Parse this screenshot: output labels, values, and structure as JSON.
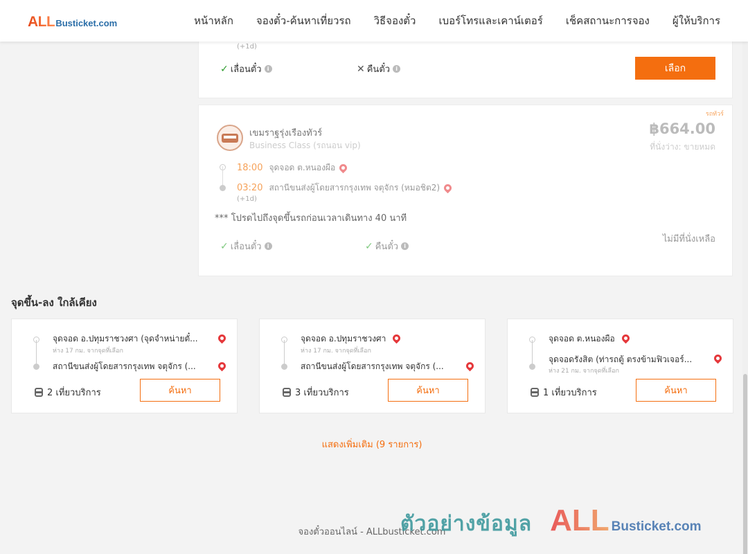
{
  "header": {
    "logo_all": "ALL",
    "logo_rest": "Busticket.com",
    "nav": [
      "หน้าหลัก",
      "จองตั๋ว-ค้นหาเที่ยวรถ",
      "วิธีจองตั๋ว",
      "เบอร์โทรและเคาน์เตอร์",
      "เช็คสถานะการจอง",
      "ผู้ให้บริการ"
    ]
  },
  "trip1": {
    "day_offset": "(+1d)",
    "feature_change": "เลื่อนตั๋ว",
    "feature_refund": "คืนตั๋ว",
    "select_label": "เลือก"
  },
  "trip2": {
    "tag": "รถทัวร์",
    "operator": "เขมราฐรุ่งเรืองทัวร์",
    "class": "Business Class (รถนอน vip)",
    "price": "฿664.00",
    "seats": "ที่นั่งว่าง: ขายหมด",
    "depart_time": "18:00",
    "depart_place": "จุดจอด ต.หนองผือ",
    "arrive_time": "03:20",
    "arrive_place": "สถานีขนส่งผู้โดยสารกรุงเทพ จตุจักร (หมอชิต2)",
    "day_offset": "(+1d)",
    "note": "*** โปรดไปถึงจุดขึ้นรถก่อนเวลาเดินทาง 40 นาที",
    "no_seats": "ไม่มีที่นั่งเหลือ",
    "feature_change": "เลื่อนตั๋ว",
    "feature_refund": "คืนตั๋ว"
  },
  "nearby": {
    "title": "จุดขึ้น-ลง ใกล้เคียง",
    "items": [
      {
        "from": "จุดจอด อ.ปทุมราชวงศา (จุดจำหน่ายตั๋...",
        "from_dist": "ห่าง 17 กม. จากจุดที่เลือก",
        "to": "สถานีขนส่งผู้โดยสารกรุงเทพ จตุจักร (...",
        "services": "2 เที่ยวบริการ",
        "search_label": "ค้นหา"
      },
      {
        "from": "จุดจอด อ.ปทุมราชวงศา",
        "from_dist": "ห่าง 17 กม. จากจุดที่เลือก",
        "to": "สถานีขนส่งผู้โดยสารกรุงเทพ จตุจักร (...",
        "services": "3 เที่ยวบริการ",
        "search_label": "ค้นหา"
      },
      {
        "from": "จุดจอด ต.หนองผือ",
        "to": "จุดจอดรังสิต (ท่ารถตู้ ตรงข้ามฟิวเจอร์...",
        "to_dist": "ห่าง 21 กม. จากจุดที่เลือก",
        "services": "1 เที่ยวบริการ",
        "search_label": "ค้นหา"
      }
    ],
    "show_more": "แสดงเพิ่มเติม (9 รายการ)"
  },
  "footer": {
    "text": "จองตั๋วออนไลน์ - ALLbusticket.com"
  },
  "watermark": {
    "thai": "ตัวอย่างข้อมูล",
    "all": "ALL",
    "rest": "Busticket.com"
  },
  "colors": {
    "accent": "#f46e0f",
    "check": "#2e9c2e",
    "pin": "#e5383b"
  }
}
